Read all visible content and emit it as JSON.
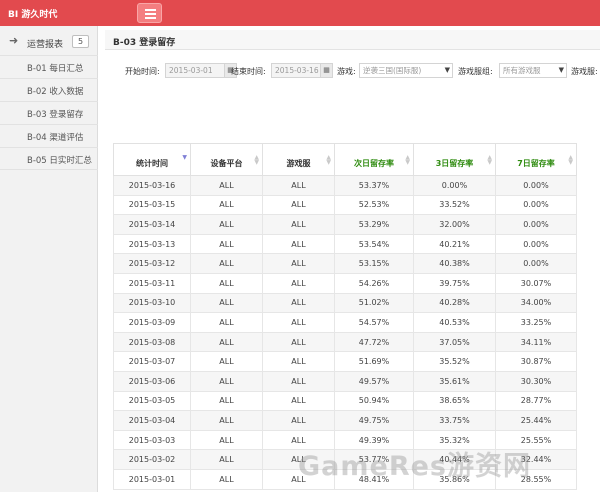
{
  "app": {
    "brand": "BI 游久时代"
  },
  "sidebar": {
    "section_label": "运营报表",
    "section_badge": "5",
    "items": [
      {
        "label": "B-01 每日汇总"
      },
      {
        "label": "B-02 收入数据"
      },
      {
        "label": "B-03 登录留存"
      },
      {
        "label": "B-04 渠道评估"
      },
      {
        "label": "B-05 日实时汇总"
      }
    ]
  },
  "page": {
    "title": "B-03 登录留存"
  },
  "filters": {
    "start_label": "开始时间:",
    "start_value": "2015-03-01",
    "end_label": "结束时间:",
    "end_value": "2015-03-16",
    "game_label": "游戏:",
    "game_value": "逆袭三国(国际服)",
    "group_label": "游戏服组:",
    "group_value": "所有游戏服",
    "server_label": "游戏服:"
  },
  "table": {
    "headers": [
      "统计时间",
      "设备平台",
      "游戏服",
      "次日留存率",
      "3日留存率",
      "7日留存率"
    ],
    "rows": [
      [
        "2015-03-16",
        "ALL",
        "ALL",
        "53.37%",
        "0.00%",
        "0.00%"
      ],
      [
        "2015-03-15",
        "ALL",
        "ALL",
        "52.53%",
        "33.52%",
        "0.00%"
      ],
      [
        "2015-03-14",
        "ALL",
        "ALL",
        "53.29%",
        "32.00%",
        "0.00%"
      ],
      [
        "2015-03-13",
        "ALL",
        "ALL",
        "53.54%",
        "40.21%",
        "0.00%"
      ],
      [
        "2015-03-12",
        "ALL",
        "ALL",
        "53.15%",
        "40.38%",
        "0.00%"
      ],
      [
        "2015-03-11",
        "ALL",
        "ALL",
        "54.26%",
        "39.75%",
        "30.07%"
      ],
      [
        "2015-03-10",
        "ALL",
        "ALL",
        "51.02%",
        "40.28%",
        "34.00%"
      ],
      [
        "2015-03-09",
        "ALL",
        "ALL",
        "54.57%",
        "40.53%",
        "33.25%"
      ],
      [
        "2015-03-08",
        "ALL",
        "ALL",
        "47.72%",
        "37.05%",
        "34.11%"
      ],
      [
        "2015-03-07",
        "ALL",
        "ALL",
        "51.69%",
        "35.52%",
        "30.87%"
      ],
      [
        "2015-03-06",
        "ALL",
        "ALL",
        "49.57%",
        "35.61%",
        "30.30%"
      ],
      [
        "2015-03-05",
        "ALL",
        "ALL",
        "50.94%",
        "38.65%",
        "28.77%"
      ],
      [
        "2015-03-04",
        "ALL",
        "ALL",
        "49.75%",
        "33.75%",
        "25.44%"
      ],
      [
        "2015-03-03",
        "ALL",
        "ALL",
        "49.39%",
        "35.32%",
        "25.55%"
      ],
      [
        "2015-03-02",
        "ALL",
        "ALL",
        "53.77%",
        "40.44%",
        "32.44%"
      ],
      [
        "2015-03-01",
        "ALL",
        "ALL",
        "48.41%",
        "35.86%",
        "28.55%"
      ]
    ]
  },
  "watermark": "GameRes游资网",
  "colors": {
    "topbar": "#e24a4e",
    "retention_header": "#2e8b0f"
  },
  "icons": {
    "menu": "hamburger-icon",
    "section": "arrow-right-icon",
    "calendar": "calendar-icon",
    "sort": "sort-icon"
  }
}
